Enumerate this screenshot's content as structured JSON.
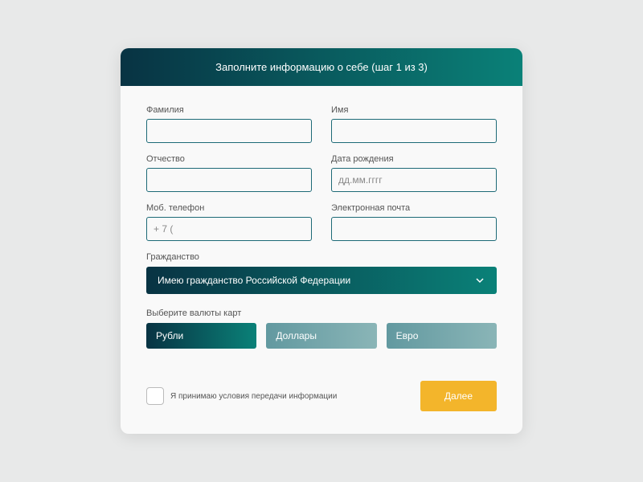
{
  "header": {
    "title": "Заполните информацию о себе (шаг 1 из 3)"
  },
  "fields": {
    "surname": {
      "label": "Фамилия",
      "value": ""
    },
    "name": {
      "label": "Имя",
      "value": ""
    },
    "patronymic": {
      "label": "Отчество",
      "value": ""
    },
    "dob": {
      "label": "Дата рождения",
      "placeholder": "дд.мм.гггг"
    },
    "phone": {
      "label": "Моб. телефон",
      "placeholder": "+ 7 ("
    },
    "email": {
      "label": "Электронная почта",
      "value": ""
    }
  },
  "citizenship": {
    "label": "Гражданство",
    "selected": "Имею гражданство Российской Федерации"
  },
  "currency": {
    "label": "Выберите валюты карт",
    "options": [
      "Рубли",
      "Доллары",
      "Евро"
    ]
  },
  "consent": {
    "label": "Я принимаю условия передачи информации"
  },
  "next": {
    "label": "Далее"
  }
}
